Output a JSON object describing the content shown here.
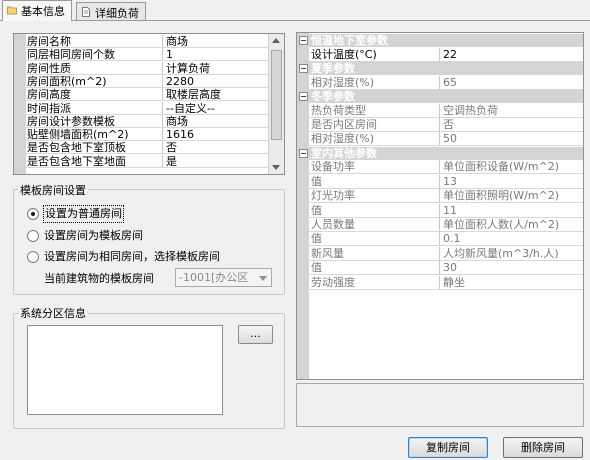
{
  "tabs": [
    {
      "label": "基本信息",
      "active": true,
      "icon": "folder-icon"
    },
    {
      "label": "详细负荷",
      "active": false,
      "icon": "document-icon"
    }
  ],
  "room_props": [
    {
      "key": "房间名称",
      "value": "商场"
    },
    {
      "key": "同层相同房间个数",
      "value": "1"
    },
    {
      "key": "房间性质",
      "value": "计算负荷"
    },
    {
      "key": "房间面积(m^2)",
      "value": "2280"
    },
    {
      "key": "房间高度",
      "value": "取楼层高度"
    },
    {
      "key": "时间指派",
      "value": "--自定义--"
    },
    {
      "key": "房间设计参数模板",
      "value": "商场"
    },
    {
      "key": "贴壁侧墙面积(m^2)",
      "value": "1616"
    },
    {
      "key": "是否包含地下室顶板",
      "value": "否"
    },
    {
      "key": "是否包含地下室地面",
      "value": "是"
    }
  ],
  "template_group": {
    "title": "模板房间设置",
    "options": [
      {
        "label": "设置为普通房间",
        "selected": true
      },
      {
        "label": "设置房间为模板房间",
        "selected": false
      },
      {
        "label": "设置房间为相同房间，选择模板房间",
        "selected": false
      }
    ],
    "combo_label": "当前建筑物的模板房间",
    "combo_value": "-1001[办公区"
  },
  "zone_group": {
    "title": "系统分区信息",
    "browse_label": "..."
  },
  "design_grid": [
    {
      "type": "category",
      "label": "恒温地下室参数"
    },
    {
      "type": "row",
      "key": "设计温度(°C)",
      "value": "22",
      "dim": false
    },
    {
      "type": "category",
      "label": "夏季参数"
    },
    {
      "type": "row",
      "key": "相对湿度(%)",
      "value": "65",
      "dim": true
    },
    {
      "type": "category",
      "label": "冬季参数"
    },
    {
      "type": "row",
      "key": "热负荷类型",
      "value": "空调热负荷",
      "dim": true
    },
    {
      "type": "row",
      "key": "是否内区房间",
      "value": "否",
      "dim": true
    },
    {
      "type": "row",
      "key": "相对湿度(%)",
      "value": "50",
      "dim": true
    },
    {
      "type": "category",
      "label": "室内其他参数"
    },
    {
      "type": "row",
      "key": "设备功率",
      "value": "单位面积设备(W/m^2)",
      "dim": true
    },
    {
      "type": "row",
      "key": "值",
      "value": "13",
      "dim": true
    },
    {
      "type": "row",
      "key": "灯光功率",
      "value": "单位面积照明(W/m^2)",
      "dim": true
    },
    {
      "type": "row",
      "key": "值",
      "value": "11",
      "dim": true
    },
    {
      "type": "row",
      "key": "人员数量",
      "value": "单位面积人数(人/m^2)",
      "dim": true
    },
    {
      "type": "row",
      "key": "值",
      "value": "0.1",
      "dim": true
    },
    {
      "type": "row",
      "key": "新风量",
      "value": "人均新风量(m^3/h.人)",
      "dim": true
    },
    {
      "type": "row",
      "key": "值",
      "value": "30",
      "dim": true
    },
    {
      "type": "row",
      "key": "劳动强度",
      "value": "静坐",
      "dim": true
    }
  ],
  "buttons": {
    "copy": "复制房间",
    "delete": "删除房间"
  },
  "colors": {
    "category_bg": "#d4d4d4",
    "focus_border": "#3c7fb1"
  }
}
